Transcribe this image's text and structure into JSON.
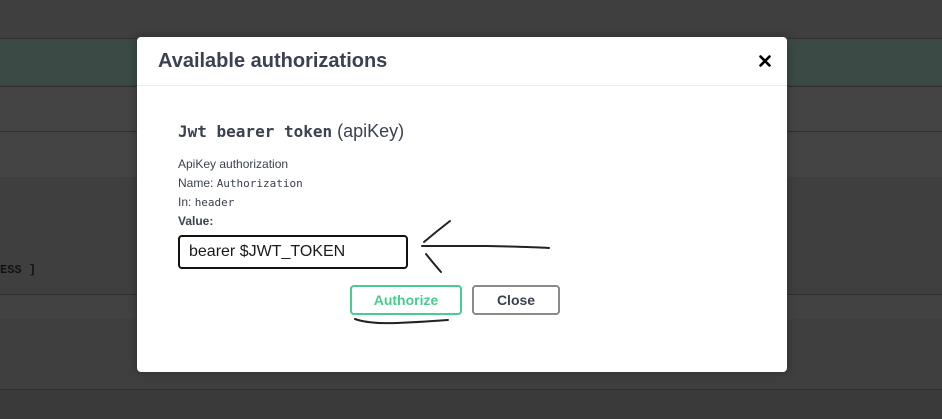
{
  "background": {
    "fragment_text": "ESS ]"
  },
  "modal": {
    "title": "Available authorizations",
    "close_icon": "close-x-icon",
    "auth": {
      "scheme_name": "Jwt bearer token",
      "scheme_type": "(apiKey)",
      "description": "ApiKey authorization",
      "name_label": "Name:",
      "name_value": "Authorization",
      "in_label": "In:",
      "in_value": "header",
      "value_label": "Value:",
      "value_input": "bearer $JWT_TOKEN"
    },
    "buttons": {
      "authorize": "Authorize",
      "close": "Close"
    }
  },
  "colors": {
    "authorize_green": "#49cc90",
    "text": "#3b4151",
    "overlay": "#3f3f3f"
  }
}
